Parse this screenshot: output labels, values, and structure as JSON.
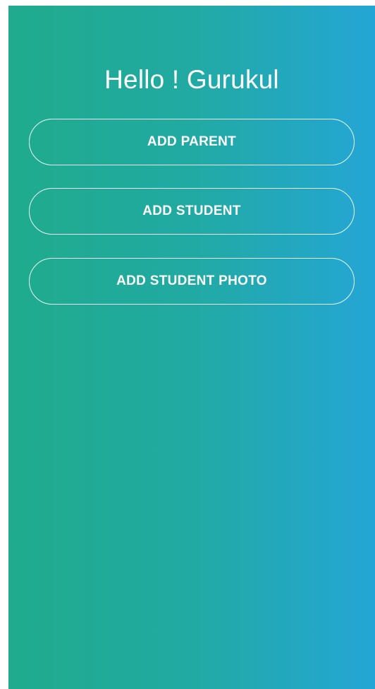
{
  "header": {
    "title": "Hello ! Gurukul"
  },
  "actions": {
    "add_parent_label": "ADD PARENT",
    "add_student_label": "ADD STUDENT",
    "add_student_photo_label": "ADD STUDENT PHOTO"
  },
  "colors": {
    "gradient_start": "#1fab8c",
    "gradient_end": "#24a6d6",
    "text": "#ffffff"
  }
}
